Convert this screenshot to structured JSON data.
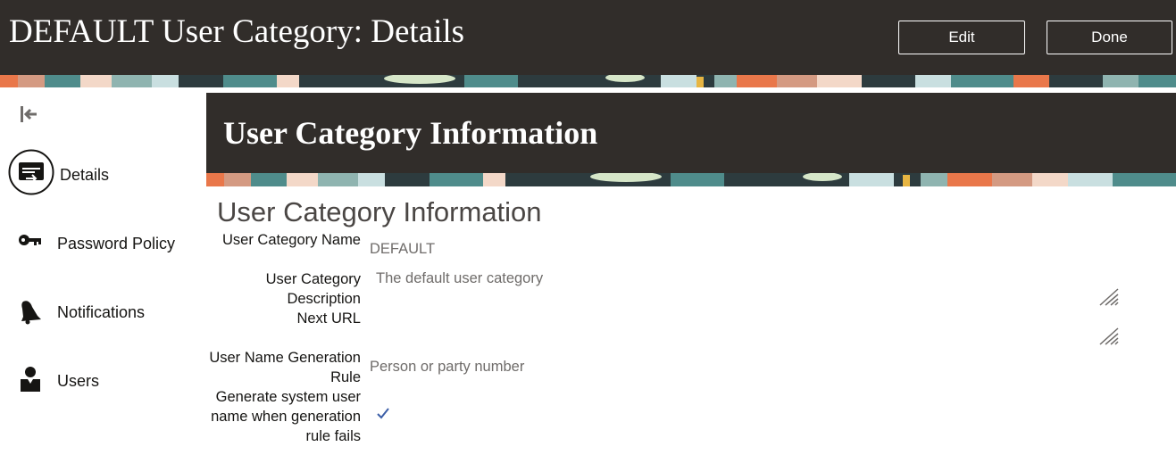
{
  "header": {
    "title": "DEFAULT User Category: Details",
    "edit_label": "Edit",
    "done_label": "Done"
  },
  "nav": {
    "collapse_icon": "collapse-left-icon",
    "items": [
      {
        "label": "Details",
        "icon": "details-card-icon",
        "selected": true
      },
      {
        "label": "Password Policy",
        "icon": "key-icon"
      },
      {
        "label": "Notifications",
        "icon": "bell-icon"
      },
      {
        "label": "Users",
        "icon": "user-icon"
      }
    ]
  },
  "section": {
    "banner_title": "User Category Information",
    "form_title": "User Category Information"
  },
  "form": {
    "user_category_name": {
      "label": "User Category Name",
      "value": "DEFAULT"
    },
    "user_category_description": {
      "label": "User Category Description",
      "value": "The default user category"
    },
    "next_url": {
      "label": "Next URL",
      "value": ""
    },
    "user_name_generation_rule": {
      "label": "User Name Generation Rule",
      "value": "Person or party number"
    },
    "generate_system_user_name": {
      "label": "Generate system user name when generation rule fails",
      "checked": true
    }
  },
  "colors": {
    "header_bg": "#312d2a",
    "accent_check": "#3b5ea7",
    "banner_teal": "#4f8c8b",
    "banner_orange": "#e9774a",
    "banner_dark": "#2d3b3e"
  }
}
